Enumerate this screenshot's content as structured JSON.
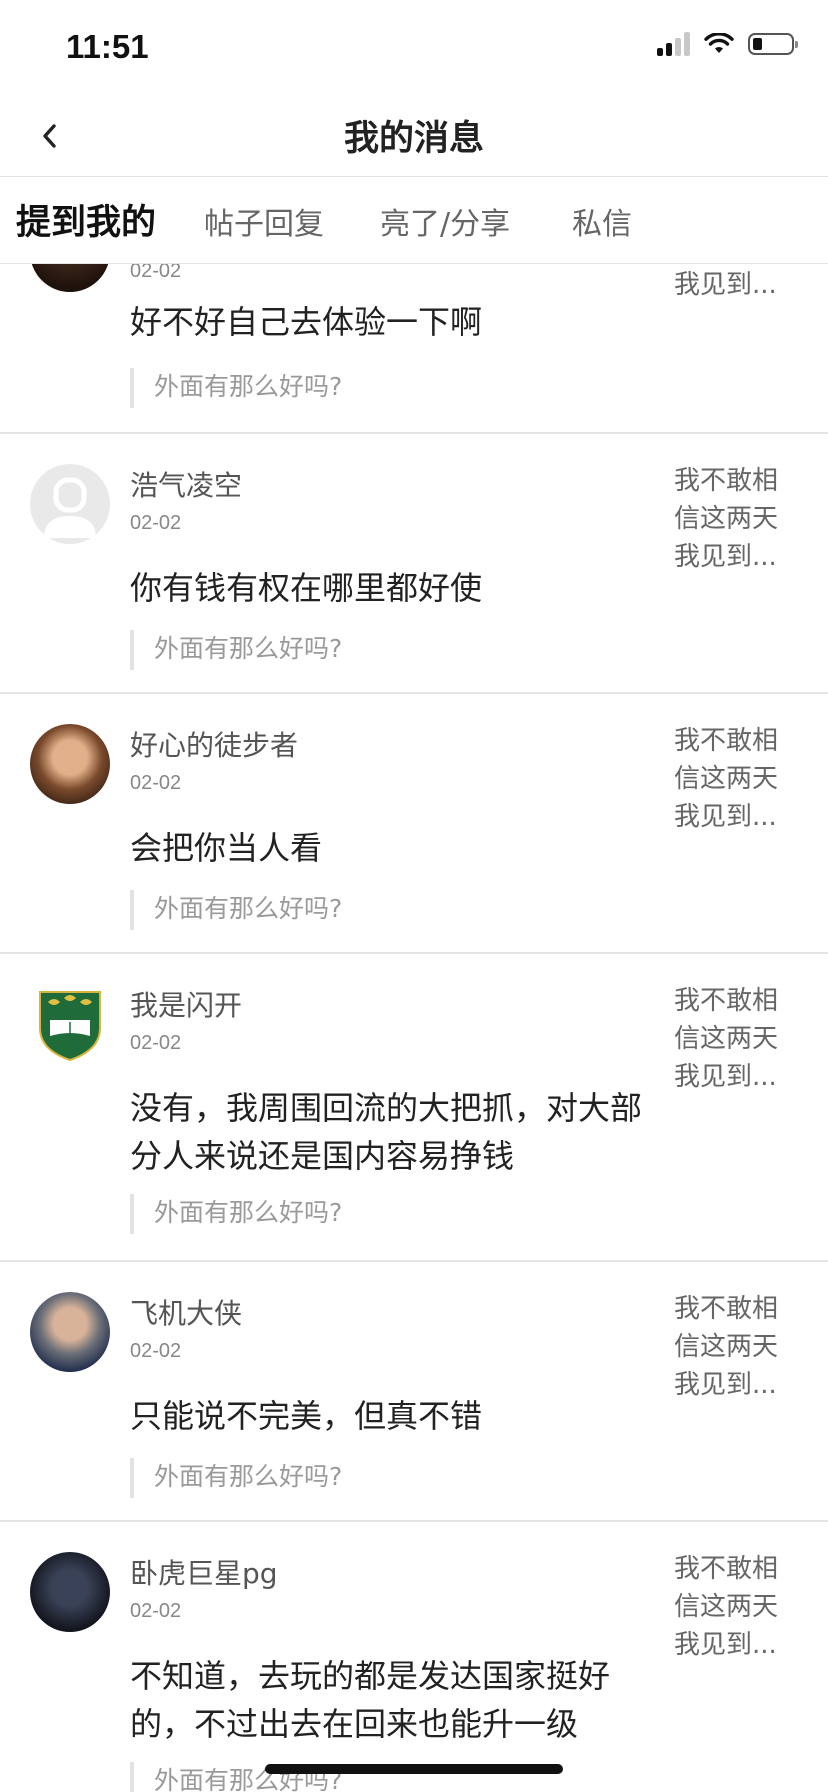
{
  "status_bar": {
    "time": "11:51"
  },
  "nav": {
    "title": "我的消息"
  },
  "tabs": [
    {
      "label": "提到我的",
      "active": true
    },
    {
      "label": "帖子回复",
      "active": false
    },
    {
      "label": "亮了/分享",
      "active": false
    },
    {
      "label": "私信",
      "active": false
    }
  ],
  "items": [
    {
      "author": "",
      "date": "02-02",
      "content": "好不好自己去体验一下啊",
      "quote": "外面有那么好吗?",
      "excerpt": "我不敢相信这两天我见到...",
      "avatar": "dark-photo-avatar"
    },
    {
      "author": "浩气凌空",
      "date": "02-02",
      "content": "你有钱有权在哪里都好使",
      "quote": "外面有那么好吗?",
      "excerpt": "我不敢相信这两天我见到...",
      "avatar": "default-user-avatar"
    },
    {
      "author": "好心的徒步者",
      "date": "02-02",
      "content": "会把你当人看",
      "quote": "外面有那么好吗?",
      "excerpt": "我不敢相信这两天我见到...",
      "avatar": "portrait-avatar"
    },
    {
      "author": "我是闪开",
      "date": "02-02",
      "content": "没有，我周围回流的大把抓，对大部分人来说还是国内容易挣钱",
      "quote": "外面有那么好吗?",
      "excerpt": "我不敢相信这两天我见到...",
      "avatar": "shield-crest-avatar"
    },
    {
      "author": "飞机大侠",
      "date": "02-02",
      "content": "只能说不完美，但真不错",
      "quote": "外面有那么好吗?",
      "excerpt": "我不敢相信这两天我见到...",
      "avatar": "man-portrait-avatar"
    },
    {
      "author": "卧虎巨星pg",
      "date": "02-02",
      "content": "不知道，去玩的都是发达国家挺好的，不过出去在回来也能升一级",
      "quote": "外面有那么好吗?",
      "excerpt": "我不敢相信这两天我见到...",
      "avatar": "batman-avatar"
    }
  ]
}
